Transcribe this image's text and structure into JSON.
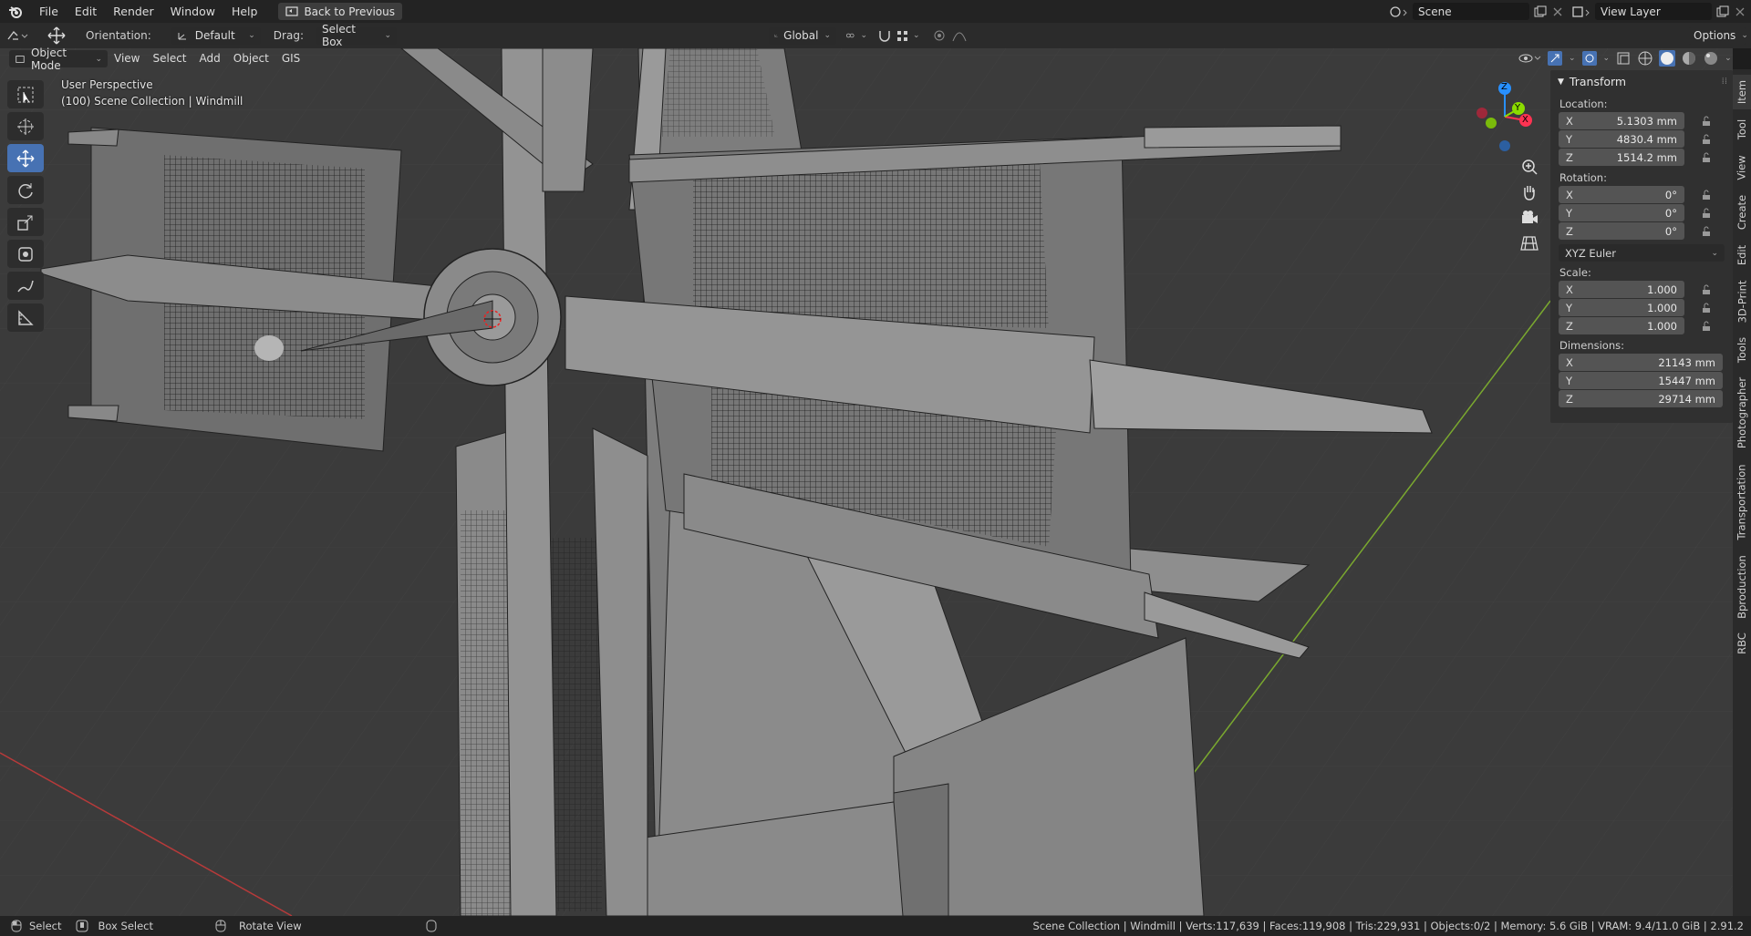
{
  "menu": {
    "file": "File",
    "edit": "Edit",
    "render": "Render",
    "window": "Window",
    "help": "Help",
    "back": "Back to Previous"
  },
  "scene": {
    "name": "Scene",
    "view_layer": "View Layer"
  },
  "header": {
    "orientation_label": "Orientation:",
    "orientation_value": "Default",
    "drag_label": "Drag:",
    "drag_value": "Select Box",
    "transform_space": "Global",
    "options": "Options"
  },
  "viewport_header": {
    "mode": "Object Mode",
    "view": "View",
    "select": "Select",
    "add": "Add",
    "object": "Object",
    "gis": "GIS"
  },
  "overlay": {
    "perspective": "User Perspective",
    "collection": "(100) Scene Collection | Windmill"
  },
  "gizmo": {
    "x": "X",
    "y": "Y",
    "z": "Z"
  },
  "npanel": {
    "title": "Transform",
    "location_label": "Location:",
    "location": [
      {
        "axis": "X",
        "value": "5.1303 mm"
      },
      {
        "axis": "Y",
        "value": "4830.4 mm"
      },
      {
        "axis": "Z",
        "value": "1514.2 mm"
      }
    ],
    "rotation_label": "Rotation:",
    "rotation": [
      {
        "axis": "X",
        "value": "0°"
      },
      {
        "axis": "Y",
        "value": "0°"
      },
      {
        "axis": "Z",
        "value": "0°"
      }
    ],
    "rotation_mode": "XYZ Euler",
    "scale_label": "Scale:",
    "scale": [
      {
        "axis": "X",
        "value": "1.000"
      },
      {
        "axis": "Y",
        "value": "1.000"
      },
      {
        "axis": "Z",
        "value": "1.000"
      }
    ],
    "dimensions_label": "Dimensions:",
    "dimensions": [
      {
        "axis": "X",
        "value": "21143 mm"
      },
      {
        "axis": "Y",
        "value": "15447 mm"
      },
      {
        "axis": "Z",
        "value": "29714 mm"
      }
    ]
  },
  "tabs": [
    "Item",
    "Tool",
    "View",
    "Create",
    "Edit",
    "3D-Print",
    "Tools",
    "Photographer",
    "Transportation",
    "Bproduction",
    "RBC"
  ],
  "status": {
    "select": "Select",
    "box_select": "Box Select",
    "rotate_view": "Rotate View",
    "stats": "Scene Collection | Windmill | Verts:117,639 | Faces:119,908 | Tris:229,931 | Objects:0/2 | Memory: 5.6 GiB | VRAM: 9.4/11.0 GiB | 2.91.2"
  },
  "colors": {
    "accent": "#4772b3",
    "x_axis": "#ff3352",
    "y_axis": "#8bdc00",
    "z_axis": "#2890ff"
  }
}
